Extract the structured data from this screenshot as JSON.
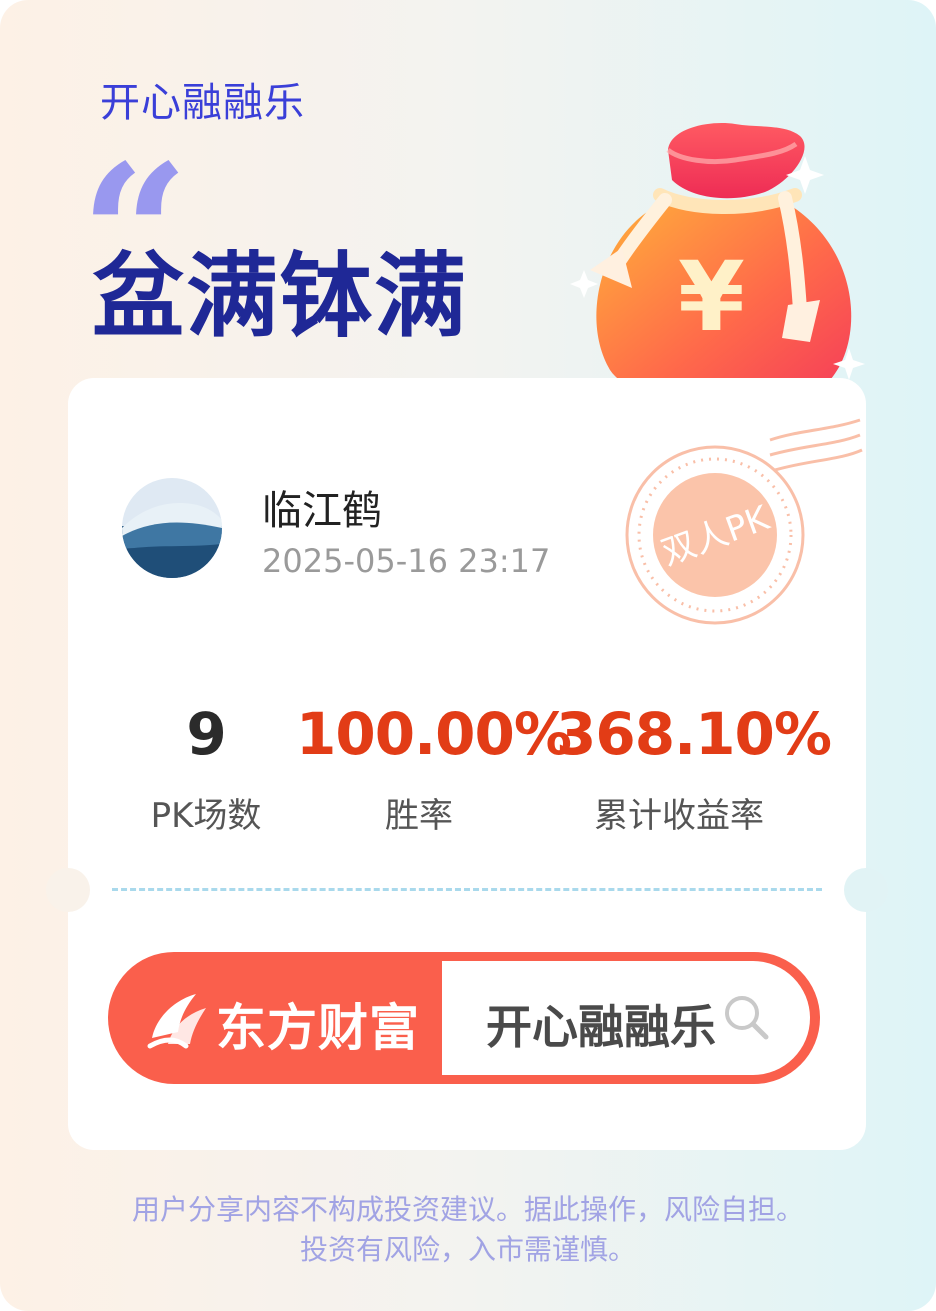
{
  "header": {
    "app_name": "开心融融乐",
    "headline": "盆满钵满",
    "quote_mark": "“"
  },
  "stamp": {
    "text": "双人PK"
  },
  "moneybag": {
    "symbol": "¥"
  },
  "user": {
    "name": "临江鹤",
    "datetime": "2025-05-16 23:17"
  },
  "stats": [
    {
      "value": "9",
      "label": "PK场数"
    },
    {
      "value": "100.00%",
      "label": "胜率"
    },
    {
      "value": "368.10%",
      "label": "累计收益率"
    }
  ],
  "search": {
    "brand": "东方财富",
    "query": "开心融融乐"
  },
  "disclaimer": {
    "line1": "用户分享内容不构成投资建议。据此操作，风险自担。",
    "line2": "投资有风险，入市需谨慎。"
  },
  "colors": {
    "title_blue": "#1f2896",
    "accent_red": "#e23c16",
    "brand_red": "#fa5f4c",
    "app_name_blue": "#3a3fd8"
  }
}
